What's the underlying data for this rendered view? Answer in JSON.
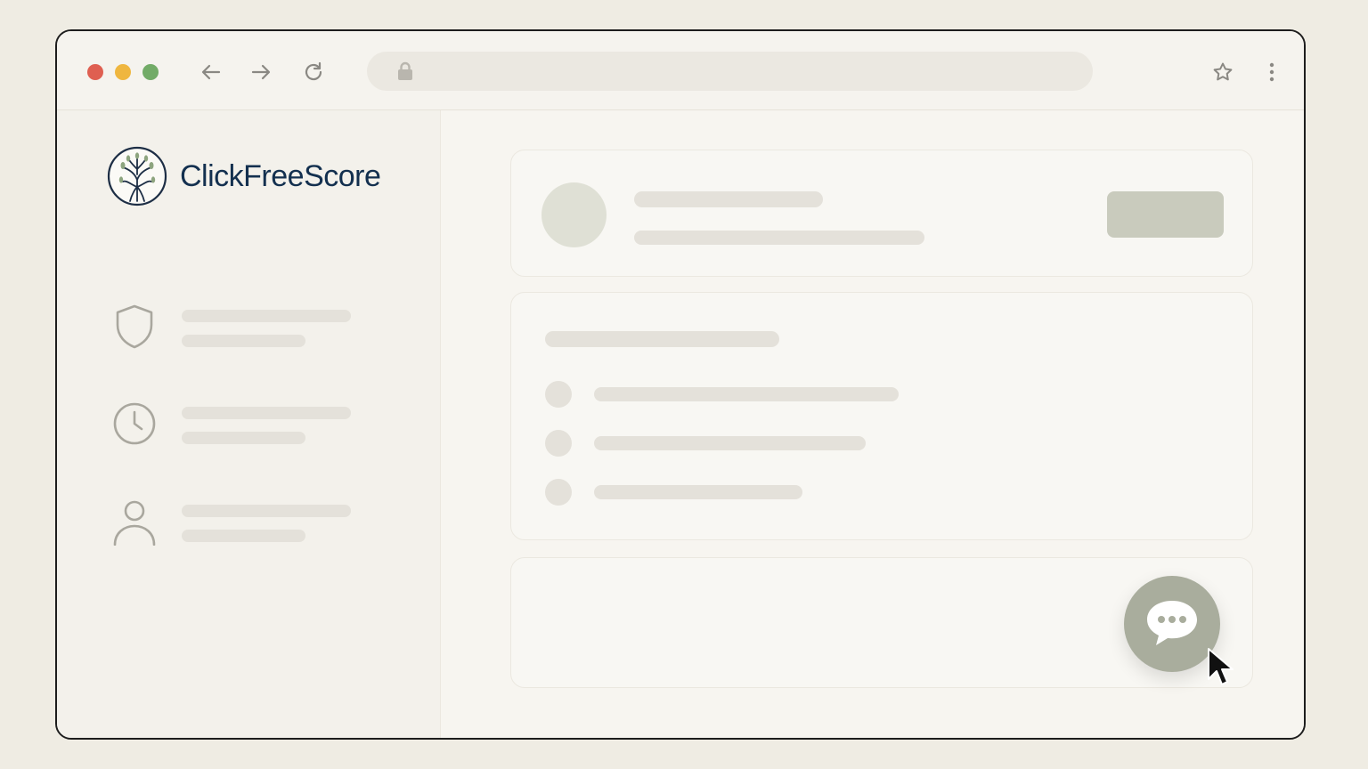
{
  "browser": {
    "url": "",
    "icons": [
      "back-arrow-icon",
      "forward-arrow-icon",
      "reload-icon",
      "lock-icon",
      "star-icon",
      "more-vertical-icon"
    ]
  },
  "sidebar": {
    "brand_name": "ClickFreeScore",
    "items": [
      {
        "icon": "shield-icon"
      },
      {
        "icon": "clock-icon"
      },
      {
        "icon": "user-icon"
      }
    ]
  },
  "main": {
    "chat_button": {
      "icon": "chat-bubble-icon"
    }
  },
  "colors": {
    "brand_text": "#13304f",
    "accent_sage": "#a9ad9d",
    "traffic_red": "#df5f51",
    "traffic_yellow": "#efb63f",
    "traffic_green": "#72ab67"
  }
}
